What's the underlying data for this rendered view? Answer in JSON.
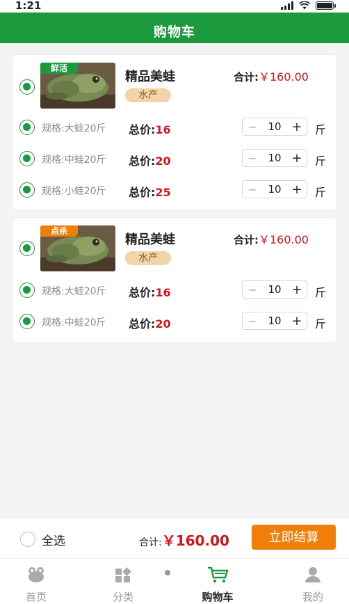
{
  "status": {
    "time": "1:21"
  },
  "header": {
    "title": "购物车"
  },
  "cards": [
    {
      "badge": "鲜活",
      "badge_color": "#1a9a3c",
      "name": "精品美蛙",
      "tag": "水产",
      "subtotal_label": "合计:",
      "subtotal_value": "￥160.00",
      "specs": [
        {
          "spec": "规格:大蛙20斤",
          "total_label": "总价:",
          "total_value": "16",
          "qty": "10",
          "unit": "斤"
        },
        {
          "spec": "规格:中蛙20斤",
          "total_label": "总价:",
          "total_value": "20",
          "qty": "10",
          "unit": "斤"
        },
        {
          "spec": "规格:小蛙20斤",
          "total_label": "总价:",
          "total_value": "25",
          "qty": "10",
          "unit": "斤"
        }
      ]
    },
    {
      "badge": "点杀",
      "badge_color": "#f07f0a",
      "name": "精品美蛙",
      "tag": "水产",
      "subtotal_label": "合计:",
      "subtotal_value": "￥160.00",
      "specs": [
        {
          "spec": "规格:大蛙20斤",
          "total_label": "总价:",
          "total_value": "16",
          "qty": "10",
          "unit": "斤"
        },
        {
          "spec": "规格:中蛙20斤",
          "total_label": "总价:",
          "total_value": "20",
          "qty": "10",
          "unit": "斤"
        }
      ]
    }
  ],
  "stepper": {
    "minus": "−",
    "plus": "+"
  },
  "footer": {
    "select_all": "全选",
    "total_label": "合计:",
    "total_value": "￥160.00",
    "checkout": "立即结算"
  },
  "tabs": [
    {
      "label": "首页",
      "icon": "frog-icon"
    },
    {
      "label": "分类",
      "icon": "category-icon"
    },
    {
      "label": "购物车",
      "icon": "cart-icon",
      "active": true
    },
    {
      "label": "我的",
      "icon": "user-icon"
    }
  ],
  "colors": {
    "primary": "#1a9a3c",
    "price": "#d4161a",
    "accent": "#f07f0a"
  }
}
